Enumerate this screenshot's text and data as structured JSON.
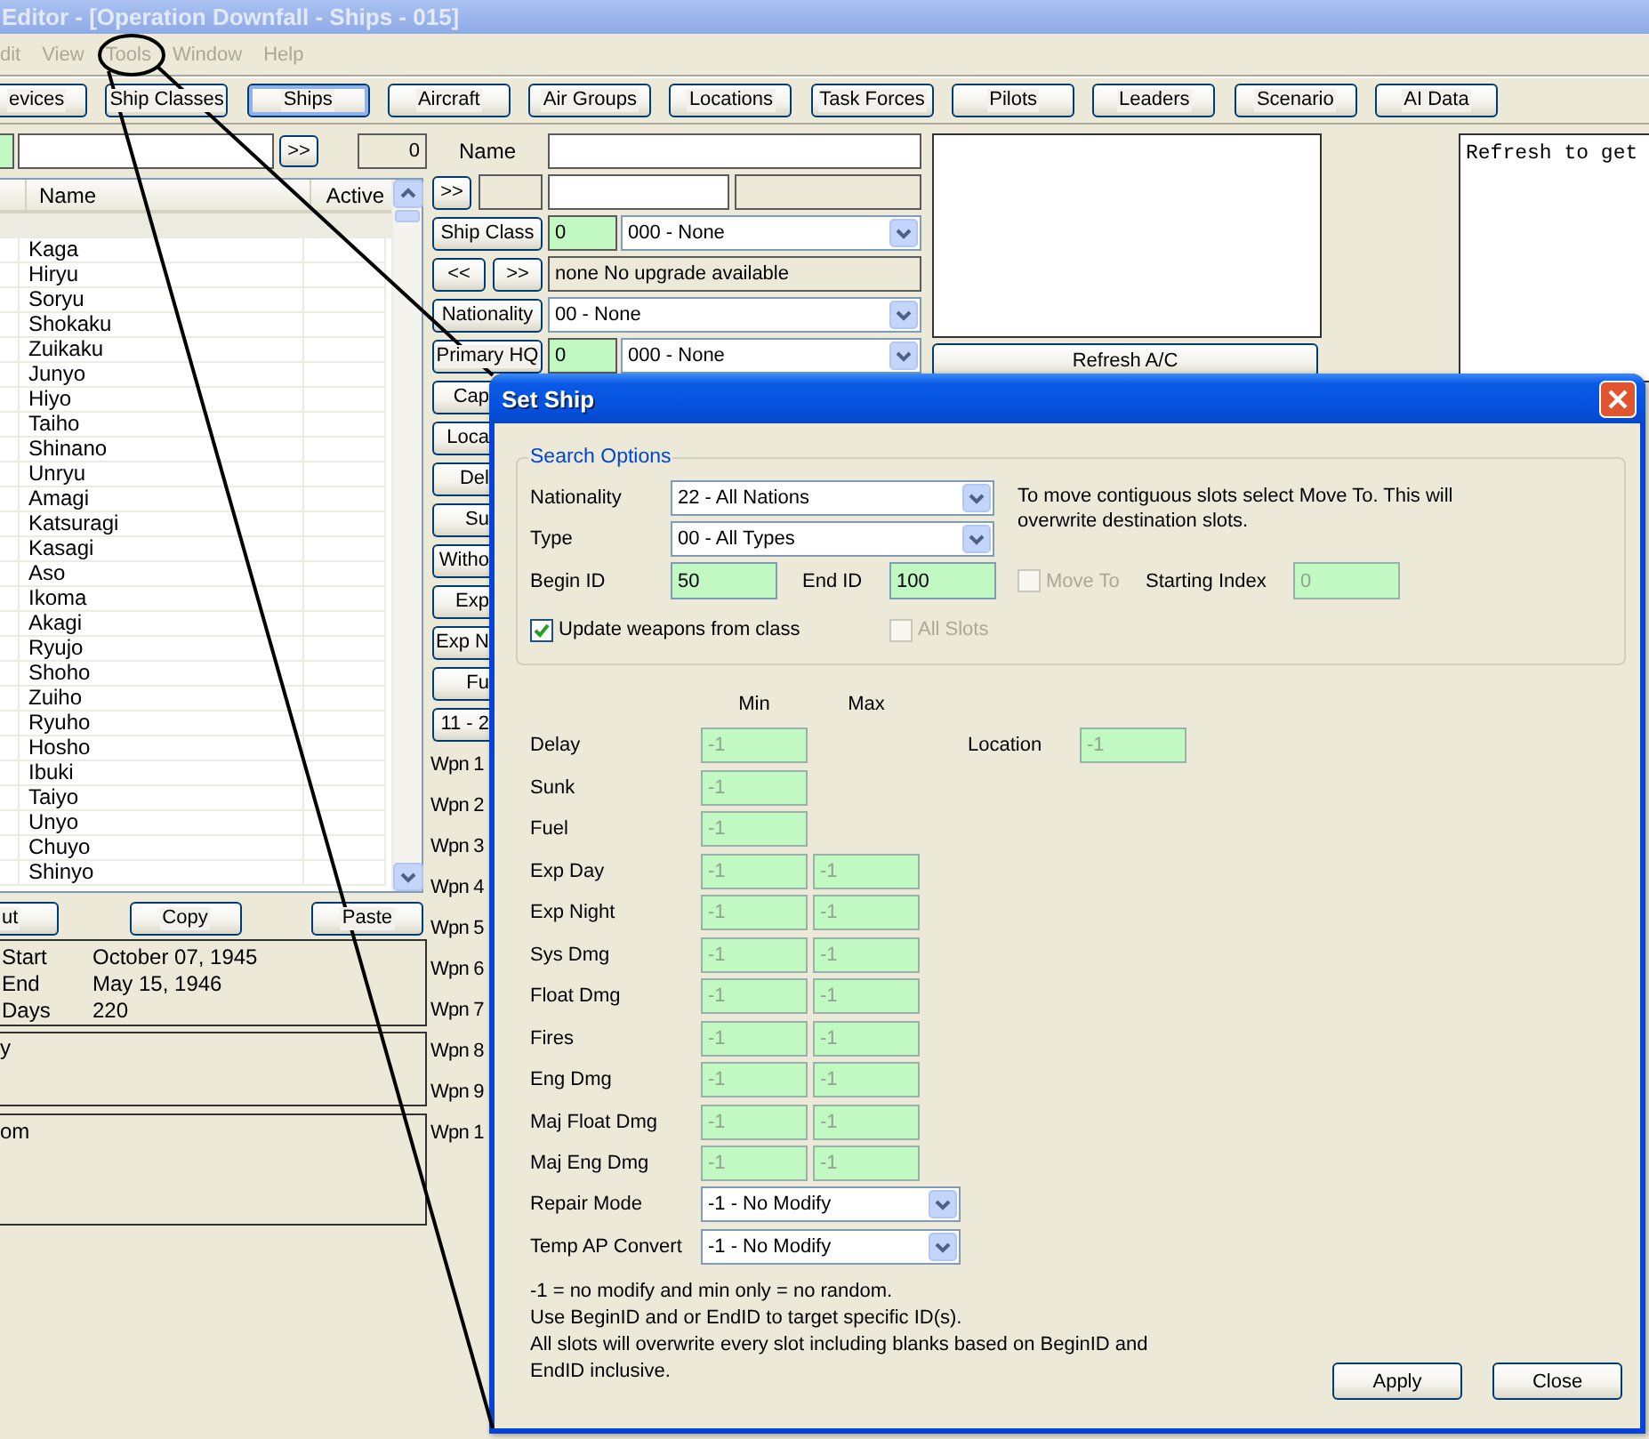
{
  "window": {
    "title": "Editor - [Operation Downfall - Ships - 015]",
    "active": false
  },
  "menu": [
    {
      "label": "dit",
      "disabled": true
    },
    {
      "label": "View",
      "disabled": true
    },
    {
      "label": "Tools",
      "disabled": true
    },
    {
      "label": "Window",
      "disabled": true
    },
    {
      "label": "Help",
      "disabled": true
    }
  ],
  "toolbar": [
    {
      "label": "evices",
      "selected": false
    },
    {
      "label": "Ship Classes",
      "selected": false
    },
    {
      "label": "Ships",
      "selected": true
    },
    {
      "label": "Aircraft",
      "selected": false
    },
    {
      "label": "Air Groups",
      "selected": false
    },
    {
      "label": "Locations",
      "selected": false
    },
    {
      "label": "Task Forces",
      "selected": false
    },
    {
      "label": "Pilots",
      "selected": false
    },
    {
      "label": "Leaders",
      "selected": false
    },
    {
      "label": "Scenario",
      "selected": false
    },
    {
      "label": "AI Data",
      "selected": false
    }
  ],
  "ship_list": {
    "search_button": ">>",
    "count": "0",
    "columns": [
      "Name",
      "Active"
    ],
    "rows": [
      {
        "selected": true
      },
      {
        "name": "Kaga",
        "selected": false
      },
      {
        "name": "Hiryu",
        "selected": false
      },
      {
        "name": "Soryu",
        "selected": false
      },
      {
        "name": "Shokaku",
        "selected": false
      },
      {
        "name": "Zuikaku",
        "selected": false
      },
      {
        "name": "Junyo",
        "selected": false
      },
      {
        "name": "Hiyo",
        "selected": false
      },
      {
        "name": "Taiho",
        "selected": false
      },
      {
        "name": "Shinano",
        "selected": false
      },
      {
        "name": "Unryu",
        "selected": false
      },
      {
        "name": "Amagi",
        "selected": false
      },
      {
        "name": "Katsuragi",
        "selected": false
      },
      {
        "name": "Kasagi",
        "selected": false
      },
      {
        "name": "Aso",
        "selected": false
      },
      {
        "name": "Ikoma",
        "selected": false
      },
      {
        "name": "Akagi",
        "selected": false
      },
      {
        "name": "Ryujo",
        "selected": false
      },
      {
        "name": "Shoho",
        "selected": false
      },
      {
        "name": "Zuiho",
        "selected": false
      },
      {
        "name": "Ryuho",
        "selected": false
      },
      {
        "name": "Hosho",
        "selected": false
      },
      {
        "name": "Ibuki",
        "selected": false
      },
      {
        "name": "Taiyo",
        "selected": false
      },
      {
        "name": "Unyo",
        "selected": false
      },
      {
        "name": "Chuyo",
        "selected": false
      },
      {
        "name": "Shinyo",
        "selected": false
      }
    ],
    "buttons": [
      "ut",
      "Copy",
      "Paste"
    ]
  },
  "dates": [
    {
      "label": "Start",
      "value": "October 07, 1945"
    },
    {
      "label": "End",
      "value": "May 15, 1946"
    },
    {
      "label": "Days",
      "value": "220"
    }
  ],
  "lower_panels": [
    "y",
    "om"
  ],
  "ship_form": {
    "name_label": "Name",
    "id_button": ">>",
    "ship_class": {
      "button": "Ship Class",
      "id": "0",
      "value": "000 - None"
    },
    "upgrade": {
      "prev_button": "<<",
      "next_button": ">>",
      "text": "none No upgrade available"
    },
    "nationality": {
      "button": "Nationality",
      "value": "00 - None"
    },
    "primary_hq": {
      "button": "Primary HQ",
      "id": "0",
      "value": "000 - None"
    },
    "more_buttons": [
      "Cap",
      "Loca",
      "Del",
      "Su",
      "Witho",
      "Exp",
      "Exp N",
      "Fu",
      "11 - 2"
    ],
    "weapon_labels": [
      "Wpn 1",
      "Wpn 2",
      "Wpn 3",
      "Wpn 4",
      "Wpn 5",
      "Wpn 6",
      "Wpn 7",
      "Wpn 8",
      "Wpn 9",
      "Wpn 1"
    ]
  },
  "aircraft_panel": {
    "refresh_button": "Refresh A/C"
  },
  "info_box": {
    "text": "Refresh to get"
  },
  "dialog": {
    "title": "Set Ship",
    "search_options": {
      "legend": "Search Options",
      "nationality": {
        "label": "Nationality",
        "value": "22 - All Nations"
      },
      "type": {
        "label": "Type",
        "value": "00 - All Types"
      },
      "begin_id": {
        "label": "Begin ID",
        "value": "50"
      },
      "end_id": {
        "label": "End ID",
        "value": "100"
      },
      "update_weapons": {
        "label": "Update weapons from class",
        "checked": true,
        "disabled": false
      },
      "all_slots": {
        "label": "All Slots",
        "checked": false,
        "disabled": true
      },
      "move_hint": "To move contiguous slots select Move To. This will overwrite destination slots.",
      "move_to": {
        "label": "Move To",
        "checked": false,
        "disabled": true
      },
      "starting_index": {
        "label": "Starting Index",
        "value": "0",
        "disabled": true
      }
    },
    "modifiers": {
      "min_heading": "Min",
      "max_heading": "Max",
      "disabled": true,
      "rows": [
        {
          "label": "Delay",
          "min": "-1"
        },
        {
          "label": "Sunk",
          "min": "-1"
        },
        {
          "label": "Fuel",
          "min": "-1"
        },
        {
          "label": "Exp Day",
          "min": "-1",
          "max": "-1"
        },
        {
          "label": "Exp Night",
          "min": "-1",
          "max": "-1"
        },
        {
          "label": "Sys Dmg",
          "min": "-1",
          "max": "-1"
        },
        {
          "label": "Float Dmg",
          "min": "-1",
          "max": "-1"
        },
        {
          "label": "Fires",
          "min": "-1",
          "max": "-1"
        },
        {
          "label": "Eng Dmg",
          "min": "-1",
          "max": "-1"
        },
        {
          "label": "Maj Float Dmg",
          "min": "-1",
          "max": "-1"
        },
        {
          "label": "Maj Eng Dmg",
          "min": "-1",
          "max": "-1"
        }
      ],
      "location": {
        "label": "Location",
        "value": "-1"
      }
    },
    "mode_selects": [
      {
        "label": "Repair Mode",
        "value": "-1 - No Modify"
      },
      {
        "label": "Temp AP Convert",
        "value": "-1 - No Modify"
      }
    ],
    "notes": [
      "-1 = no modify and min only = no random.",
      "Use BeginID and or EndID to target specific ID(s).",
      "All slots will overwrite every slot including blanks based on BeginID and EndID inclusive."
    ],
    "buttons": [
      "Apply",
      "Close"
    ]
  }
}
